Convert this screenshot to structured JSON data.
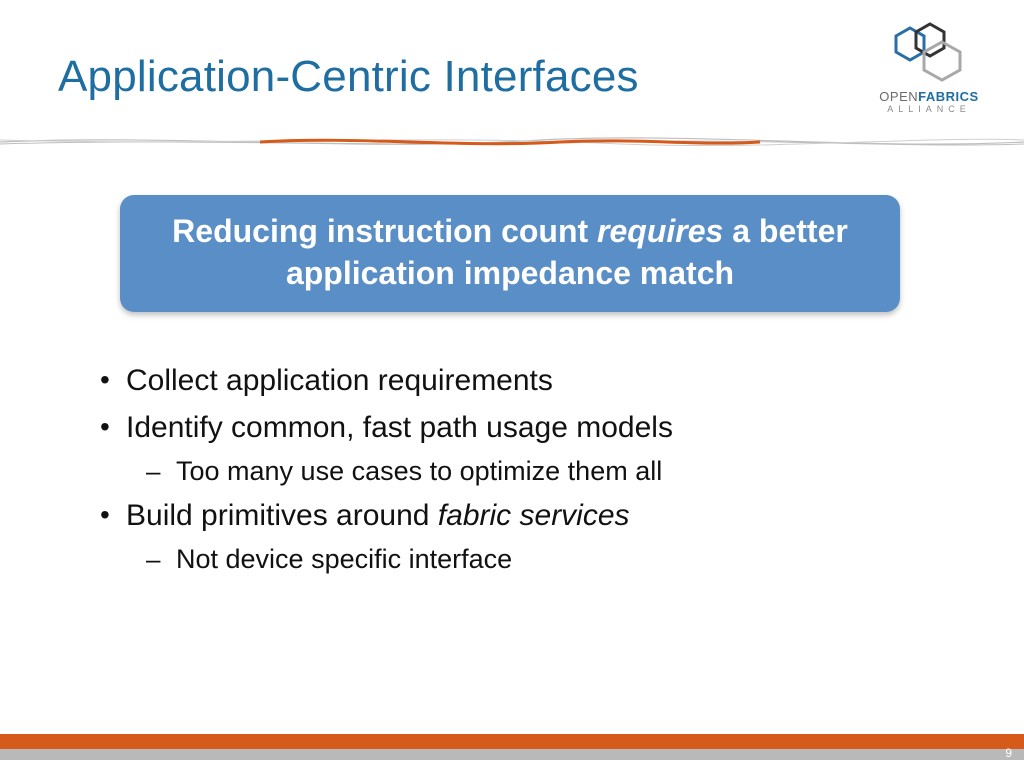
{
  "title": "Application-Centric Interfaces",
  "logo": {
    "open": "OPEN",
    "fabrics": "FABRICS",
    "sub": "ALLIANCE"
  },
  "callout": {
    "part1": "Reducing instruction count ",
    "em": "requires",
    "part2": " a better application impedance match"
  },
  "bullets": {
    "b1": "Collect application requirements",
    "b2": "Identify common, fast path usage models",
    "b2a": "Too many use cases to optimize them all",
    "b3_pre": "Build primitives around ",
    "b3_em": "fabric services",
    "b3a": "Not device specific interface"
  },
  "page": "9"
}
